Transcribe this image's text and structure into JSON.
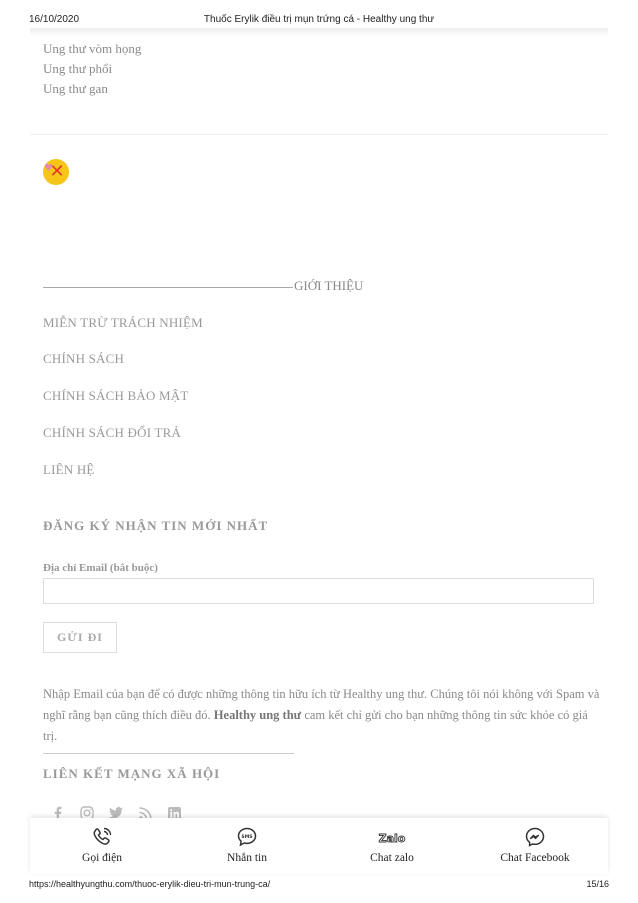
{
  "print_header": {
    "date": "16/10/2020",
    "title": "Thuốc Erylik điều trị mụn trứng cá - Healthy ung thư"
  },
  "cancer_list": [
    "Ung thư vòm họng",
    "Ung thư phổi",
    "Ung thư gan"
  ],
  "intro": {
    "title": "GIỚI THIỆU",
    "menu": [
      "MIỄN TRỪ TRÁCH NHIỆM",
      "CHÍNH SÁCH",
      "CHÍNH SÁCH BẢO MẬT",
      "CHÍNH SÁCH ĐỔI TRẢ",
      "LIÊN HỆ"
    ]
  },
  "newsletter": {
    "heading": "ĐĂNG KÝ NHẬN TIN MỚI NHẤT",
    "email_label": "Địa chỉ Email (bắt buộc)",
    "email_value": "",
    "submit_label": "GỬI ĐI",
    "desc_before": "Nhập Email của bạn để có được những thông tin hữu ích từ Healthy ung thư. Chúng tôi nói không với Spam và nghĩ rằng bạn cũng thích điều đó. ",
    "desc_brand": "Healthy ung thư",
    "desc_after": " cam kết chỉ gửi cho bạn những thông tin sức khỏe có giá trị."
  },
  "social": {
    "heading": "LIÊN KẾT MẠNG XÃ HỘI",
    "icons": [
      "facebook-icon",
      "instagram-icon",
      "twitter-icon",
      "rss-icon",
      "linkedin-icon"
    ]
  },
  "contact_bar": {
    "call": "Gọi điện",
    "sms": "Nhắn tin",
    "zalo": "Chat zalo",
    "facebook": "Chat Facebook",
    "zalo_logo_text": "Zalo",
    "sms_icon_text": "SMS"
  },
  "print_footer": {
    "url": "https://healthyungthu.com/thuoc-erylik-dieu-tri-mun-trung-ca/",
    "page": "15/16"
  },
  "colors": {
    "text_muted": "#8a8a8a",
    "heading": "#999999",
    "badge_yellow": "#f5c518",
    "badge_red": "#e23b2e"
  }
}
